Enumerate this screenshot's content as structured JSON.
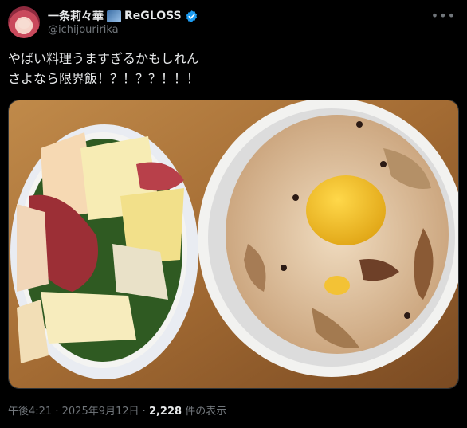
{
  "author": {
    "display_name": "一条莉々華",
    "unit_name": "ReGLOSS",
    "handle": "@ichijouririka",
    "verified": true
  },
  "tweet": {
    "text": "やばい料理うますぎるかもしれん\nさよなら限界飯！？！？？！！！",
    "image_alt": "bowl of peach and prosciutto salad beside a bowl of mushroom rice topped with a chestnut"
  },
  "meta": {
    "time": "午後4:21",
    "separator": "·",
    "date": "2025年9月12日",
    "views_count": "2,228",
    "views_label": "件の表示"
  },
  "icons": {
    "verified": "verified-badge-icon",
    "more": "more-options-icon"
  },
  "colors": {
    "background": "#000000",
    "text": "#e7e9ea",
    "muted": "#71767b",
    "verified": "#1d9bf0"
  }
}
